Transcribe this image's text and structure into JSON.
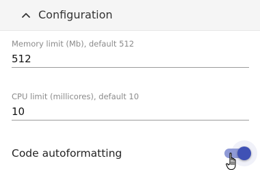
{
  "section": {
    "title": "Configuration",
    "expanded": true
  },
  "fields": {
    "memory": {
      "label": "Memory limit (Mb), default 512",
      "value": "512"
    },
    "cpu": {
      "label": "CPU limit (millicores), default 10",
      "value": "10"
    }
  },
  "toggle": {
    "label": "Code autoformatting",
    "checked": true
  },
  "colors": {
    "accent": "#3f51b5",
    "accent_track": "#8f9ad6",
    "header_bg": "#f5f5f5"
  },
  "icons": {
    "collapse": "chevron-up-icon",
    "pointer": "hand-pointer-icon"
  }
}
